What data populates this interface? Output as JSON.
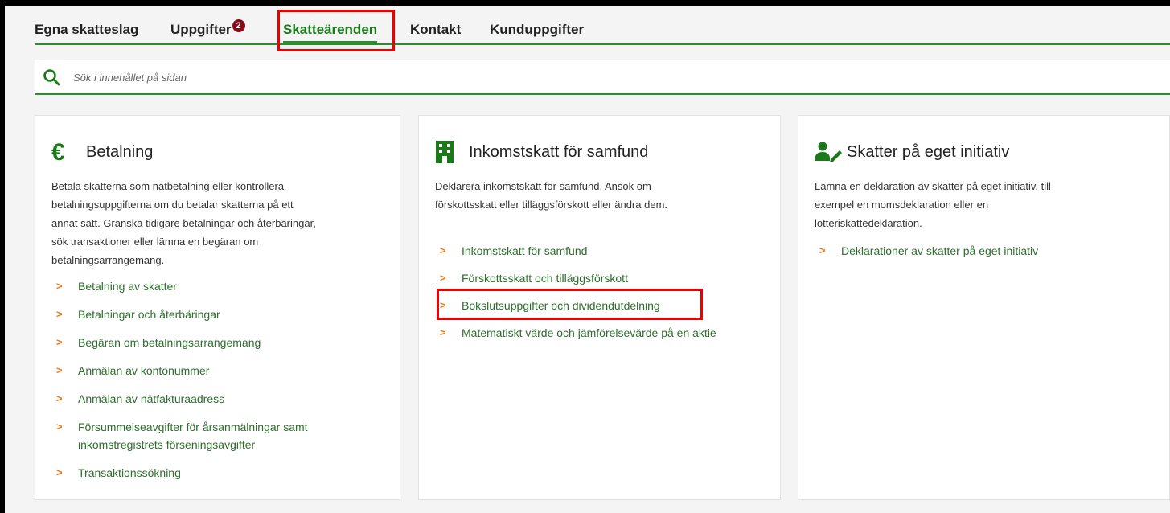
{
  "tabs": [
    {
      "label": "Egna skatteslag"
    },
    {
      "label": "Uppgifter",
      "badge": "2"
    },
    {
      "label": "Skatteärenden"
    },
    {
      "label": "Kontakt"
    },
    {
      "label": "Kunduppgifter"
    }
  ],
  "search": {
    "placeholder": "Sök i innehållet på sidan"
  },
  "cards": [
    {
      "icon": "euro-icon",
      "title": "Betalning",
      "desc_lines": [
        "Betala skatterna som nätbetalning eller kontrollera",
        "betalningsuppgifterna om du betalar skatterna på ett",
        "annat sätt. Granska tidigare betalningar och återbäringar,",
        "sök transaktioner eller lämna en begäran om",
        "betalningsarrangemang."
      ],
      "links": [
        {
          "label": "Betalning av skatter"
        },
        {
          "label": "Betalningar och återbäringar"
        },
        {
          "label": "Begäran om betalningsarrangemang"
        },
        {
          "label": "Anmälan av kontonummer"
        },
        {
          "label": "Anmälan av nätfakturaadress"
        },
        {
          "label_line1": "Försummelseavgifter för årsanmälningar samt",
          "label_line2": "inkomstregistrets förseningsavgifter"
        },
        {
          "label": "Transaktionssökning"
        }
      ]
    },
    {
      "icon": "building-icon",
      "title": "Inkomstskatt för samfund",
      "desc_lines": [
        "Deklarera inkomstskatt för samfund. Ansök om",
        "förskottsskatt eller tilläggsförskott eller ändra dem."
      ],
      "links": [
        {
          "label": "Inkomstskatt för samfund"
        },
        {
          "label": "Förskottsskatt och tilläggsförskott"
        },
        {
          "label": "Bokslutsuppgifter och dividendutdelning"
        },
        {
          "label": "Matematiskt värde och jämförelsevärde på en aktie"
        }
      ]
    },
    {
      "icon": "person-edit-icon",
      "title": "Skatter på eget initiativ",
      "desc_lines": [
        "Lämna en deklaration av skatter på eget initiativ, till",
        "exempel en momsdeklaration eller en",
        "lotteriskattedeklaration."
      ],
      "links": [
        {
          "label": "Deklarationer av skatter på eget initiativ"
        }
      ]
    }
  ],
  "colors": {
    "accent": "#2e8b2e",
    "chevron": "#e87a1a",
    "highlight": "#ee0000",
    "badge": "#8b0a1a"
  }
}
